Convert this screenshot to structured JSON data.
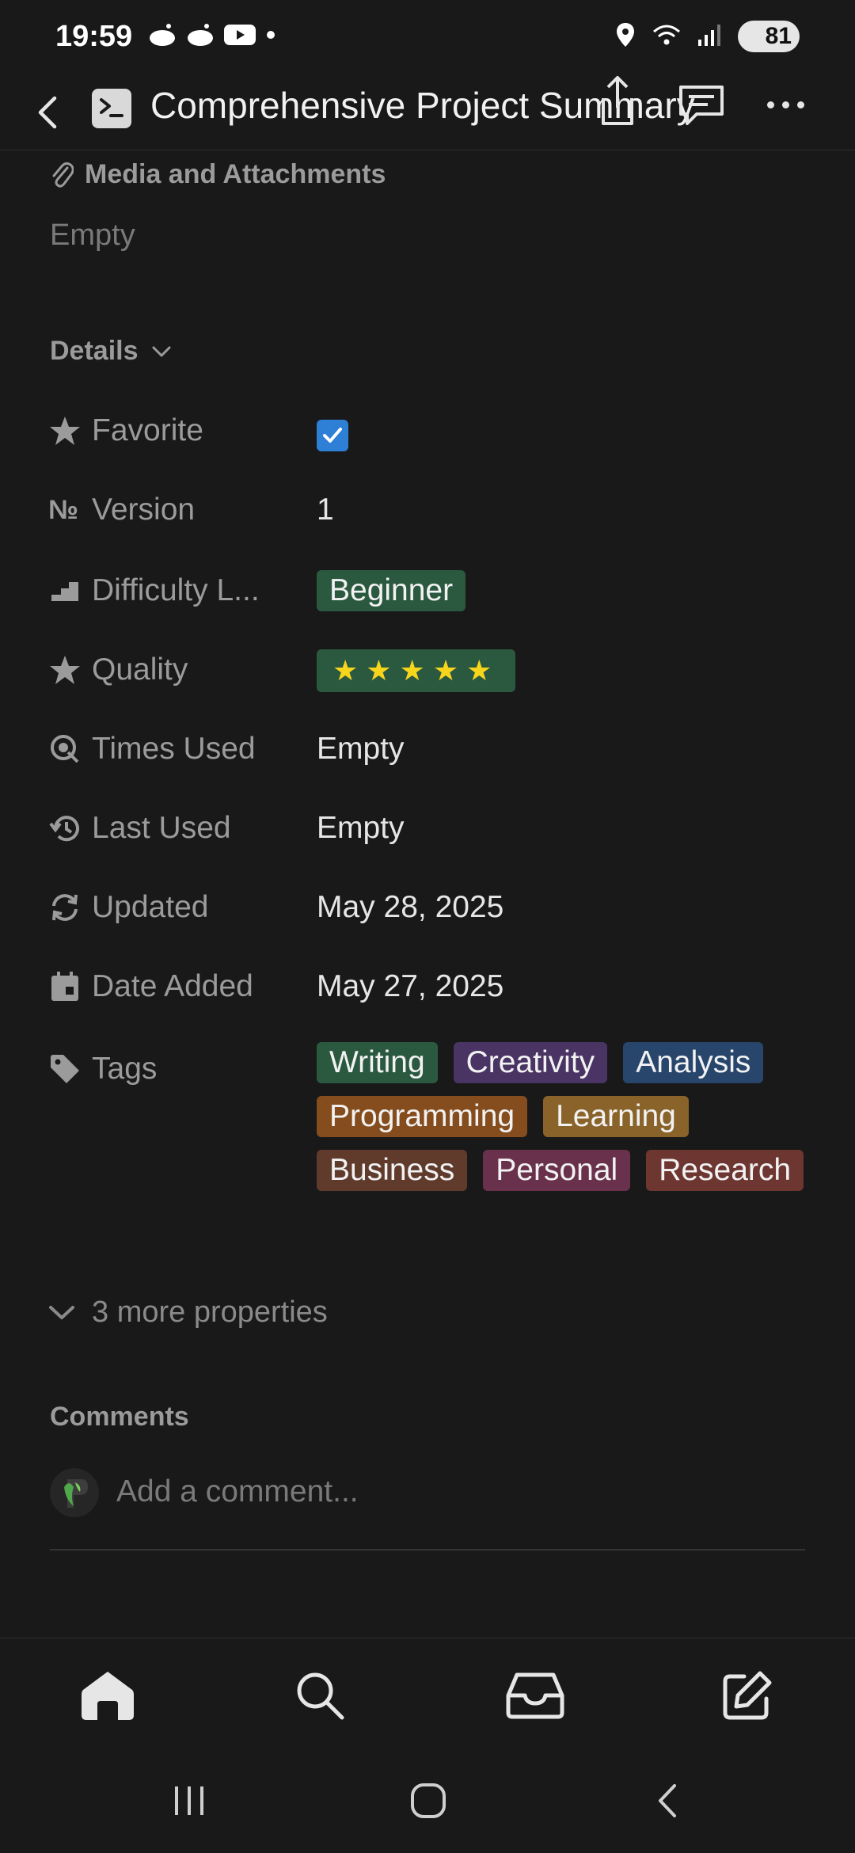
{
  "status": {
    "time": "19:59",
    "battery": "81"
  },
  "header": {
    "title": "Comprehensive Project Summary"
  },
  "media": {
    "label": "Media and Attachments",
    "value": "Empty"
  },
  "details": {
    "label": "Details"
  },
  "properties": {
    "favorite": {
      "label": "Favorite",
      "checked": true
    },
    "version": {
      "label": "Version",
      "value": "1"
    },
    "difficulty": {
      "label": "Difficulty L...",
      "value": "Beginner"
    },
    "quality": {
      "label": "Quality",
      "stars": "★★★★★",
      "rating": 5
    },
    "times_used": {
      "label": "Times Used",
      "value": "Empty"
    },
    "last_used": {
      "label": "Last Used",
      "value": "Empty"
    },
    "updated": {
      "label": "Updated",
      "value": "May 28, 2025"
    },
    "date_added": {
      "label": "Date Added",
      "value": "May 27, 2025"
    },
    "tags": {
      "label": "Tags",
      "items": [
        "Writing",
        "Creativity",
        "Analysis",
        "Programming",
        "Learning",
        "Business",
        "Personal",
        "Research"
      ]
    }
  },
  "more_properties": "3 more properties",
  "comments": {
    "label": "Comments",
    "placeholder": "Add a comment..."
  },
  "colors": {
    "background": "#191919",
    "checkbox": "#2e7fd6",
    "star": "#f7d51d"
  }
}
